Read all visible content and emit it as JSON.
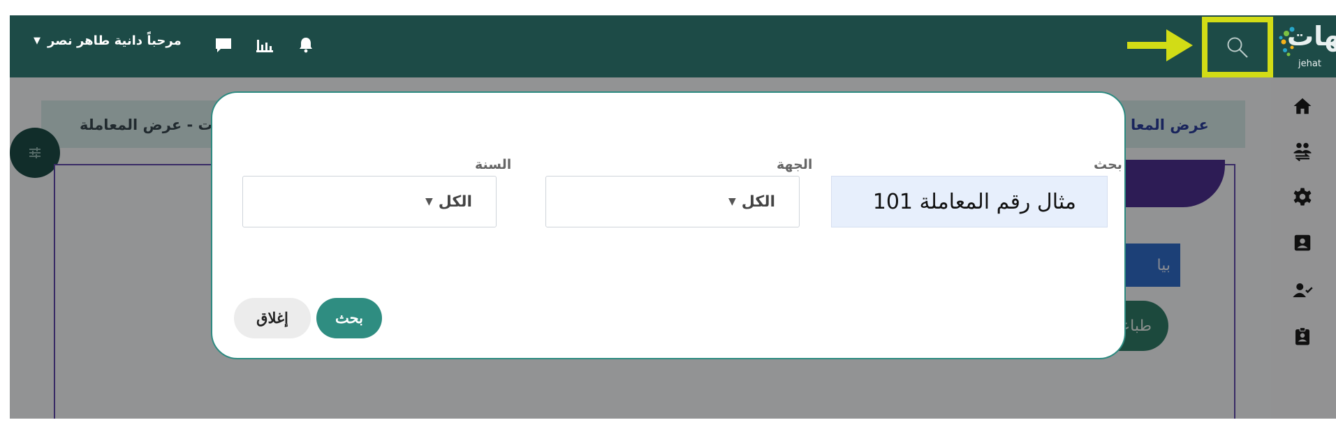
{
  "topbar": {
    "welcome_text": "مرحباً دانية طاهر نصر",
    "logo_text": "جهات",
    "logo_subtext": "jehat"
  },
  "breadcrumb": {
    "left_text": "ت - عرض المعاملة",
    "right_text": "عرض المعا"
  },
  "background_buttons": {
    "blue_label": "بيا",
    "print_label": "طباعة"
  },
  "modal": {
    "search_label": "بحث",
    "search_value": "مثال رقم المعاملة 101",
    "entity_label": "الجهة",
    "entity_value": "الكل",
    "year_label": "السنة",
    "year_value": "الكل",
    "search_button": "بحث",
    "close_button": "إغلاق"
  },
  "colors": {
    "topbar": "#1d4b47",
    "highlight": "#d2dc16",
    "primary_button": "#2f8d81",
    "modal_border": "#2c8a80"
  }
}
